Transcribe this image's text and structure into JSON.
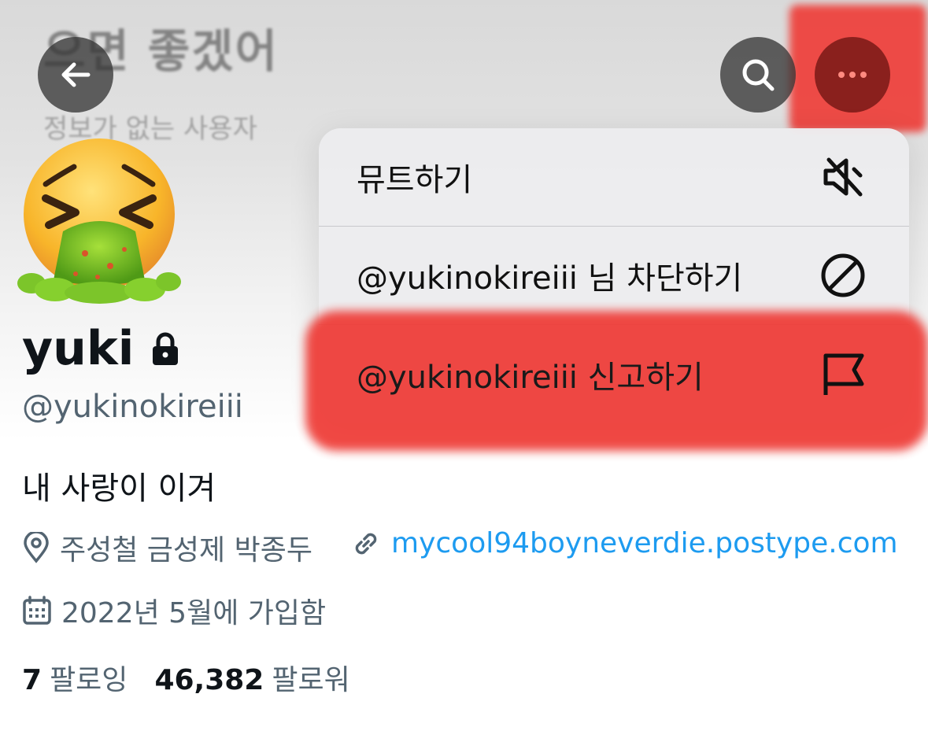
{
  "banner": {
    "title": "으면 좋겠어",
    "subtitle": "정보가 없는 사용자"
  },
  "header_buttons": {
    "back_icon": "arrow-left-icon",
    "search_icon": "search-icon",
    "more_icon": "more-dots-icon"
  },
  "menu": {
    "items": [
      {
        "label": "뮤트하기",
        "icon": "mute-speaker-icon"
      },
      {
        "label": "@yukinokireiii 님 차단하기",
        "icon": "block-icon"
      },
      {
        "label": "@yukinokireiii 신고하기",
        "icon": "flag-icon"
      }
    ]
  },
  "profile": {
    "avatar_icon": "vomiting-face-emoji",
    "name": "yuki",
    "handle": "@yukinokireiii",
    "bio": "내 사랑이 이겨",
    "location": "주성철 금성제 박종두",
    "link": "mycool94boyneverdie.postype.com",
    "joined": "2022년 5월에 가입함",
    "following_count": "7",
    "following_label": "팔로잉",
    "followers_count": "46,382",
    "followers_label": "팔로워"
  },
  "colors": {
    "link": "#1d9bf0",
    "secondary_text": "#536471",
    "primary_text": "#0f1419",
    "highlight_red": "#ef3b36"
  }
}
